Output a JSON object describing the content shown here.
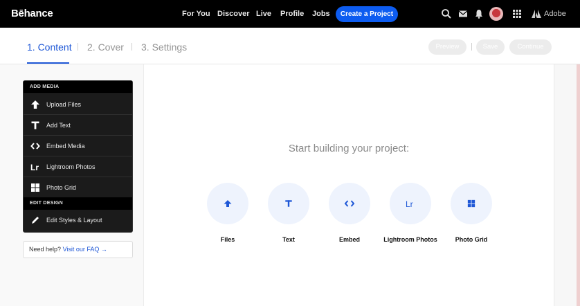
{
  "nav": {
    "logo": "Bēhance",
    "links": [
      "For You",
      "Discover",
      "Live",
      "Profile",
      "Jobs"
    ],
    "create_button": "Create a Project",
    "icons": [
      "search-icon",
      "mail-icon",
      "bell-icon",
      "avatar",
      "apps-grid-icon",
      "adobe-logo-icon"
    ],
    "adobe_label": "Adobe"
  },
  "steps": {
    "items": [
      "1. Content",
      "2. Cover",
      "3. Settings"
    ],
    "active_index": 0,
    "buttons": {
      "preview": "Preview",
      "save": "Save",
      "continue": "Continue"
    }
  },
  "media_panel": {
    "add_media_heading": "ADD MEDIA",
    "items": [
      {
        "label": "Upload Files",
        "icon": "upload-arrow-icon"
      },
      {
        "label": "Add Text",
        "icon": "text-icon"
      },
      {
        "label": "Embed Media",
        "icon": "embed-code-icon"
      },
      {
        "label": "Lightroom Photos",
        "icon": "lightroom-icon"
      },
      {
        "label": "Photo Grid",
        "icon": "photo-grid-icon"
      }
    ],
    "edit_design_heading": "EDIT DESIGN",
    "edit_items": [
      {
        "label": "Edit Styles & Layout",
        "icon": "pencil-icon"
      }
    ]
  },
  "help": {
    "prefix": "Need help?",
    "link": "Visit our FAQ →"
  },
  "canvas": {
    "title": "Start building your project:",
    "options": [
      {
        "label": "Files",
        "icon": "upload-arrow-icon"
      },
      {
        "label": "Text",
        "icon": "text-icon"
      },
      {
        "label": "Embed",
        "icon": "embed-code-icon"
      },
      {
        "label": "Lightroom Photos",
        "icon": "lightroom-icon"
      },
      {
        "label": "Photo Grid",
        "icon": "photo-grid-icon"
      }
    ]
  },
  "colors": {
    "accent": "#1e57d6",
    "nav_bg": "#000000",
    "create_btn": "#0d5cf0",
    "option_circle": "#eef3fd"
  }
}
